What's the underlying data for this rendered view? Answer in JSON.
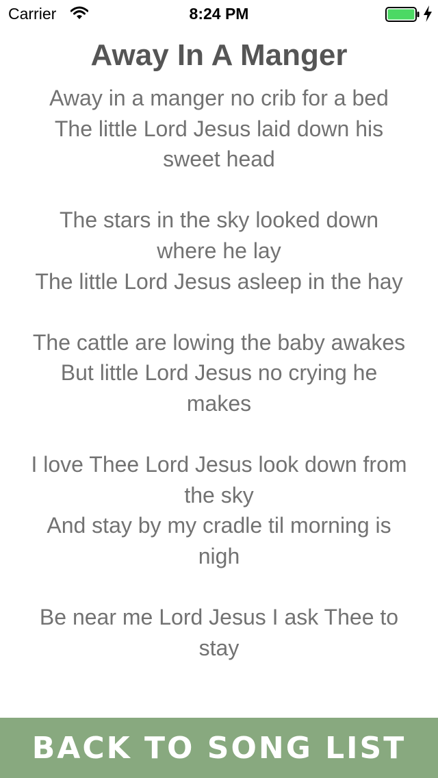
{
  "status_bar": {
    "carrier": "Carrier",
    "time": "8:24 PM",
    "wifi_icon": "wifi-icon",
    "battery_icon": "battery-full-icon",
    "charging_icon": "charging-bolt-icon",
    "battery_color": "#4cd964"
  },
  "song": {
    "title": "Away In A Manger",
    "lyrics": "Away in a manger no crib for a bed\nThe little Lord Jesus laid down his sweet head\n\nThe stars in the sky looked down where he lay\nThe little Lord Jesus asleep in the hay\n\nThe cattle are lowing the baby awakes\nBut little Lord Jesus no crying he makes\n\nI love Thee Lord Jesus look down from the sky\nAnd stay by my cradle til morning is nigh\n\nBe near me Lord Jesus I ask Thee to stay"
  },
  "footer": {
    "back_label": "BACK TO SONG LIST",
    "background_color": "#88a97f"
  },
  "colors": {
    "title": "#555555",
    "lyrics": "#727272"
  }
}
